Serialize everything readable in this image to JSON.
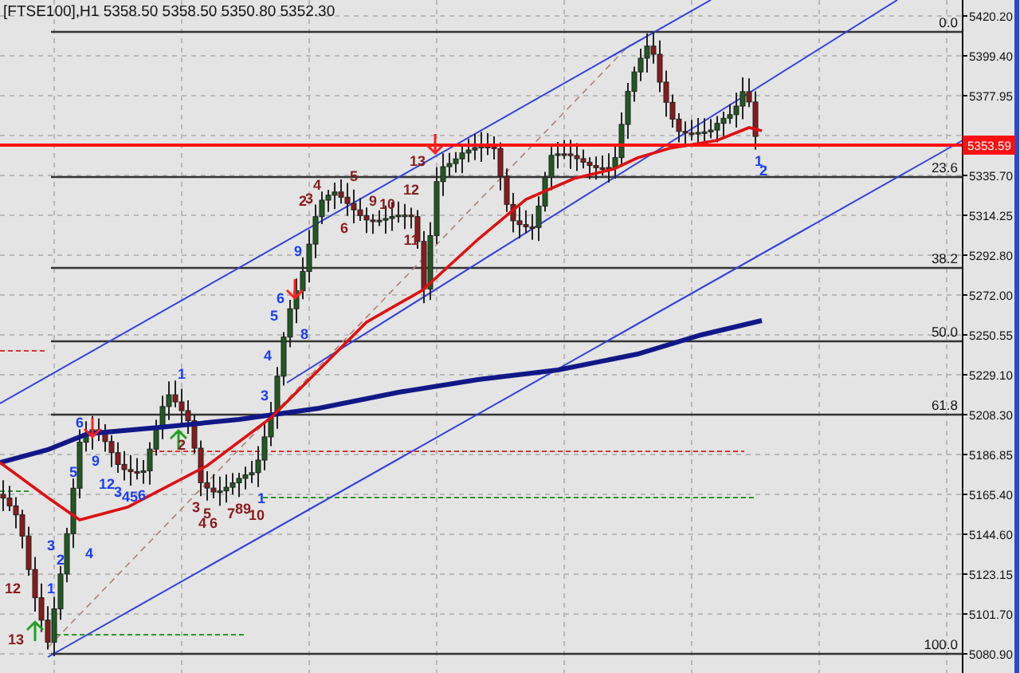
{
  "header": "[FTSE100],H1  5358.50 5358.50 5350.80 5352.30",
  "price_axis": [
    "5420.20",
    "5399.40",
    "5377.95",
    "5335.70",
    "5314.25",
    "5292.80",
    "5272.00",
    "5250.55",
    "5229.10",
    "5208.30",
    "5186.85",
    "5165.40",
    "5144.60",
    "5123.15",
    "5101.70",
    "5080.90"
  ],
  "current_price": "5353.59",
  "fib_levels": [
    "0.0",
    "23.6",
    "38.2",
    "50.0",
    "61.8",
    "100.0"
  ],
  "markers": [
    {
      "text": "13",
      "color": "#8b1a1a"
    },
    {
      "text": "1",
      "color": "#1a3cff"
    },
    {
      "text": "2",
      "color": "#1a3cff"
    },
    {
      "text": "2",
      "color": "#8b1a1a"
    },
    {
      "text": "3",
      "color": "#8b1a1a"
    },
    {
      "text": "4",
      "color": "#8b1a1a"
    },
    {
      "text": "5",
      "color": "#8b1a1a"
    },
    {
      "text": "9",
      "color": "#8b1a1a"
    },
    {
      "text": "10",
      "color": "#8b1a1a"
    },
    {
      "text": "12",
      "color": "#8b1a1a"
    },
    {
      "text": "6",
      "color": "#8b1a1a"
    },
    {
      "text": "11",
      "color": "#8b1a1a"
    },
    {
      "text": "9",
      "color": "#1a3cff"
    },
    {
      "text": "6",
      "color": "#1a3cff"
    },
    {
      "text": "8",
      "color": "#1a3cff"
    },
    {
      "text": "5",
      "color": "#1a3cff"
    },
    {
      "text": "4",
      "color": "#1a3cff"
    },
    {
      "text": "1",
      "color": "#1a3cff"
    },
    {
      "text": "3",
      "color": "#1a3cff"
    },
    {
      "text": "6",
      "color": "#1a3cff"
    },
    {
      "text": "9",
      "color": "#1a3cff"
    },
    {
      "text": "2",
      "color": "#8b1a1a"
    },
    {
      "text": "5",
      "color": "#1a3cff"
    },
    {
      "text": "12",
      "color": "#1a3cff"
    },
    {
      "text": "3",
      "color": "#1a3cff"
    },
    {
      "text": "4",
      "color": "#1a3cff"
    },
    {
      "text": "5",
      "color": "#1a3cff"
    },
    {
      "text": "6",
      "color": "#1a3cff"
    },
    {
      "text": "1",
      "color": "#1a3cff"
    },
    {
      "text": "3",
      "color": "#8b1a1a"
    },
    {
      "text": "5",
      "color": "#8b1a1a"
    },
    {
      "text": "7",
      "color": "#8b1a1a"
    },
    {
      "text": "8",
      "color": "#8b1a1a"
    },
    {
      "text": "9",
      "color": "#8b1a1a"
    },
    {
      "text": "10",
      "color": "#8b1a1a"
    },
    {
      "text": "4",
      "color": "#8b1a1a"
    },
    {
      "text": "6",
      "color": "#8b1a1a"
    },
    {
      "text": "3",
      "color": "#1a3cff"
    },
    {
      "text": "4",
      "color": "#1a3cff"
    },
    {
      "text": "2",
      "color": "#1a3cff"
    },
    {
      "text": "12",
      "color": "#8b1a1a"
    },
    {
      "text": "1",
      "color": "#1a3cff"
    },
    {
      "text": "13",
      "color": "#8b1a1a"
    }
  ]
}
